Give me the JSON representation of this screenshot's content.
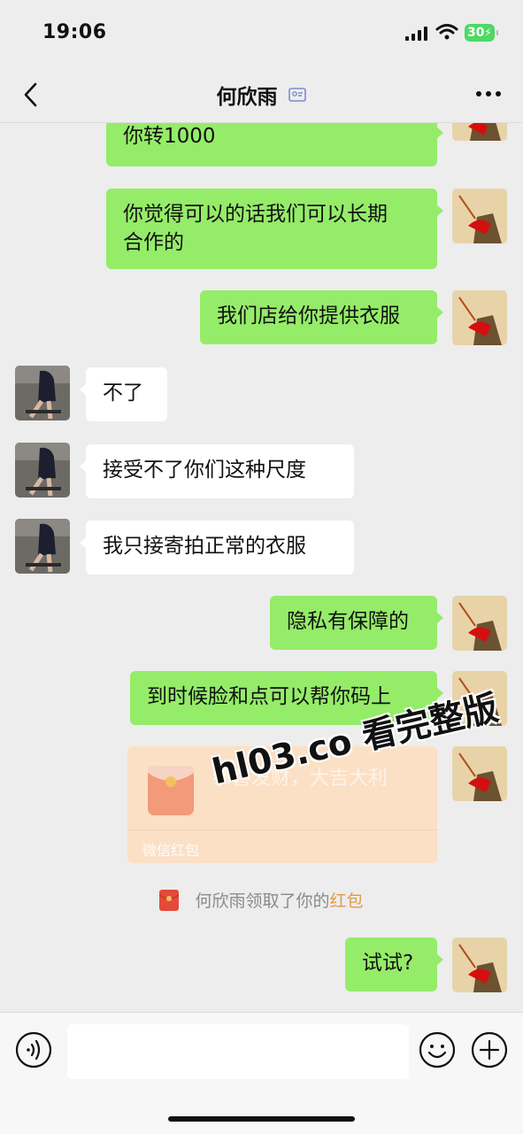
{
  "status_bar": {
    "time": "19:06",
    "battery": "30"
  },
  "nav": {
    "title": "何欣雨",
    "back_icon": "chevron-left-icon",
    "more_icon": "more-dots-icon",
    "id_icon": "contact-card-icon"
  },
  "messages": [
    {
      "from": "me",
      "text": "你转1000"
    },
    {
      "from": "me",
      "text": "你觉得可以的话我们可以长期\n合作的"
    },
    {
      "from": "me",
      "text": "我们店给你提供衣服"
    },
    {
      "from": "other",
      "text": "不了"
    },
    {
      "from": "other",
      "text": "接受不了你们这种尺度"
    },
    {
      "from": "other",
      "text": "我只接寄拍正常的衣服"
    },
    {
      "from": "me",
      "text": "隐私有保障的"
    },
    {
      "from": "me",
      "text": "到时候脸和点可以帮你码上"
    },
    {
      "from": "me",
      "type": "red_packet",
      "title": "恭喜发财，大吉大利",
      "footer": "微信红包"
    },
    {
      "type": "system",
      "text": "何欣雨领取了你的",
      "link": "红包"
    },
    {
      "from": "me",
      "text": "试试?"
    }
  ],
  "watermark": "hl03.co 看完整版",
  "colors": {
    "me_bubble": "#95ec69",
    "other_bubble": "#ffffff",
    "background": "#ededed",
    "red_packet": "#fbe0c6",
    "link": "#e19a4a"
  },
  "input_bar": {
    "voice_icon": "voice-icon",
    "emoji_icon": "emoji-icon",
    "plus_icon": "plus-icon",
    "placeholder": ""
  }
}
